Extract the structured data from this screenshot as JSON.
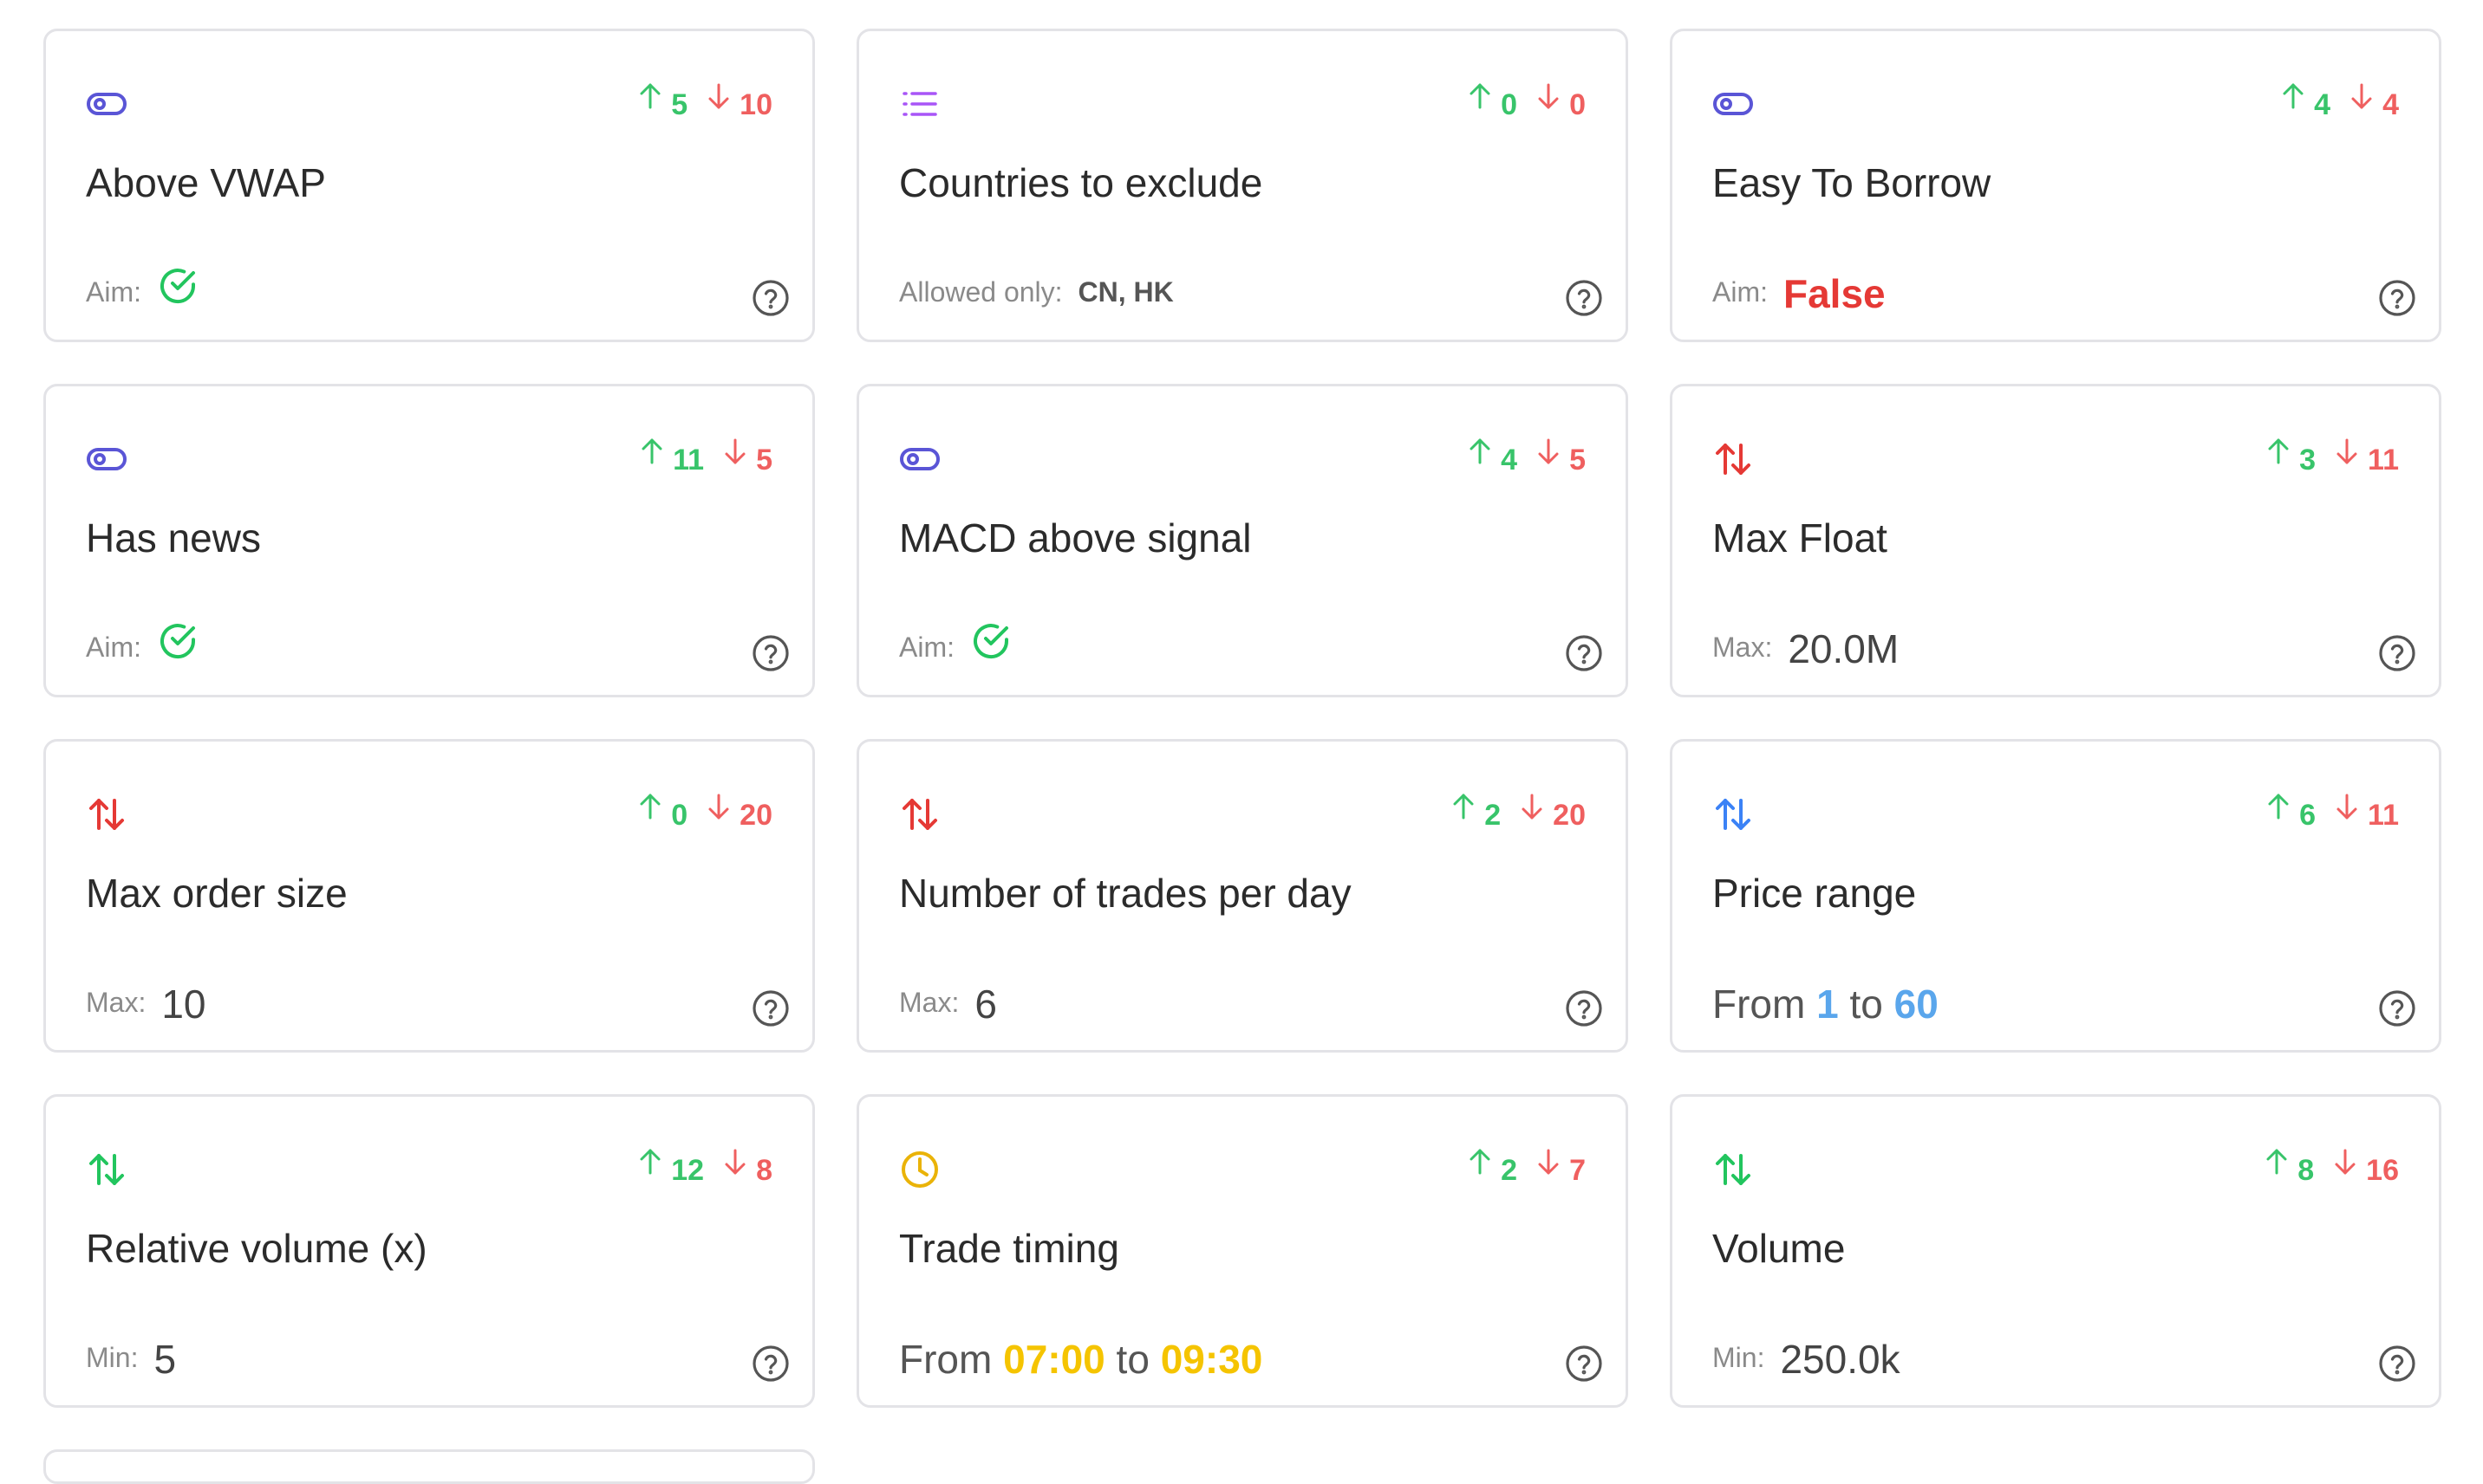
{
  "colors": {
    "toggle": "#5a55d6",
    "list": "#a855f7",
    "arrows_red": "#e53935",
    "arrows_blue": "#3b82f6",
    "arrows_green": "#22c55e",
    "clock": "#eab308",
    "up": "#38c46a",
    "down": "#ef5f5f",
    "range_blue": "#5aa6ec",
    "range_yellow": "#f5c400"
  },
  "cards": [
    {
      "id": "above-vwap",
      "icon": "toggle-icon",
      "up": "5",
      "down": "10",
      "title": "Above VWAP",
      "foot_label": "Aim:",
      "foot_type": "check"
    },
    {
      "id": "countries-exclude",
      "icon": "list-icon",
      "up": "0",
      "down": "0",
      "title": "Countries to exclude",
      "foot_label": "Allowed only:",
      "foot_value": "CN, HK",
      "foot_type": "small"
    },
    {
      "id": "easy-to-borrow",
      "icon": "toggle-icon",
      "up": "4",
      "down": "4",
      "title": "Easy To Borrow",
      "foot_label": "Aim:",
      "foot_value": "False",
      "foot_type": "false"
    },
    {
      "id": "has-news",
      "icon": "toggle-icon",
      "up": "11",
      "down": "5",
      "title": "Has news",
      "foot_label": "Aim:",
      "foot_type": "check"
    },
    {
      "id": "macd-above-signal",
      "icon": "toggle-icon",
      "up": "4",
      "down": "5",
      "title": "MACD above signal",
      "foot_label": "Aim:",
      "foot_type": "check"
    },
    {
      "id": "max-float",
      "icon": "arrows-red-icon",
      "up": "3",
      "down": "11",
      "title": "Max Float",
      "foot_label": "Max:",
      "foot_value": "20.0M",
      "foot_type": "value"
    },
    {
      "id": "max-order-size",
      "icon": "arrows-red-icon",
      "up": "0",
      "down": "20",
      "title": "Max order size",
      "foot_label": "Max:",
      "foot_value": "10",
      "foot_type": "value"
    },
    {
      "id": "trades-per-day",
      "icon": "arrows-red-icon",
      "up": "2",
      "down": "20",
      "title": "Number of trades per day",
      "foot_label": "Max:",
      "foot_value": "6",
      "foot_type": "value"
    },
    {
      "id": "price-range",
      "icon": "arrows-blue-icon",
      "up": "6",
      "down": "11",
      "title": "Price range",
      "foot_type": "range",
      "range_from_label": "From",
      "range_from": "1",
      "range_to_label": "to",
      "range_to": "60",
      "range_color": "blue"
    },
    {
      "id": "relative-volume",
      "icon": "arrows-green-icon",
      "up": "12",
      "down": "8",
      "title": "Relative volume (x)",
      "foot_label": "Min:",
      "foot_value": "5",
      "foot_type": "value"
    },
    {
      "id": "trade-timing",
      "icon": "clock-icon",
      "up": "2",
      "down": "7",
      "title": "Trade timing",
      "foot_type": "range",
      "range_from_label": "From",
      "range_from": "07:00",
      "range_to_label": "to",
      "range_to": "09:30",
      "range_color": "yellow"
    },
    {
      "id": "volume",
      "icon": "arrows-green-icon",
      "up": "8",
      "down": "16",
      "title": "Volume",
      "foot_label": "Min:",
      "foot_value": "250.0k",
      "foot_type": "value"
    }
  ]
}
